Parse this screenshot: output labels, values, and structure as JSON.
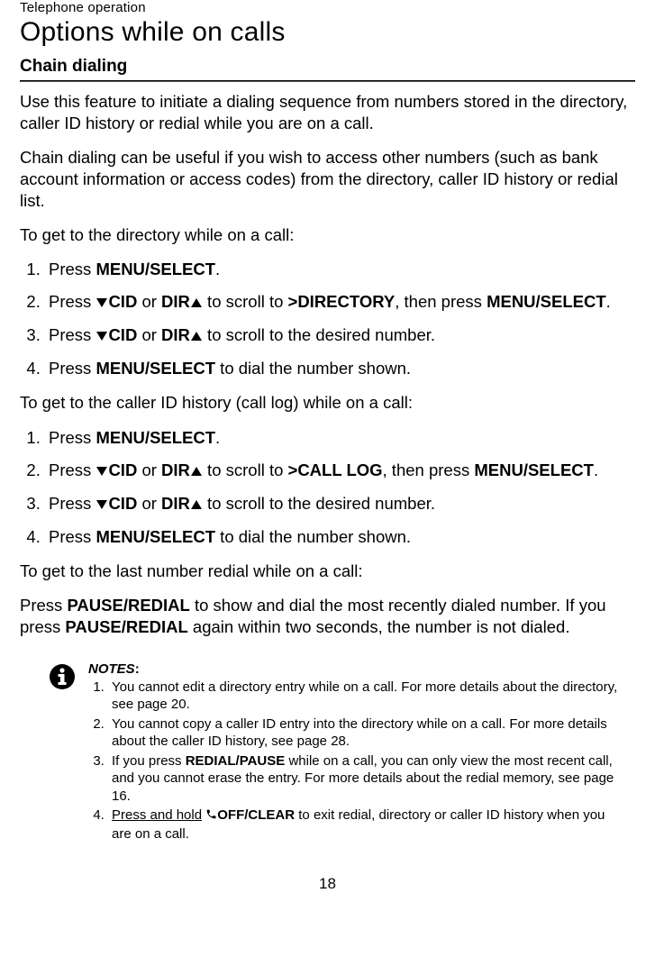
{
  "header": {
    "category": "Telephone operation",
    "title": "Options while on calls",
    "subhead": "Chain dialing"
  },
  "intro": {
    "p1": "Use this feature to initiate a dialing sequence from numbers stored in the directory, caller ID history or redial while you are on a call.",
    "p2": "Chain dialing can be useful if you wish to access other numbers (such as bank account information or access codes) from the directory, caller ID history or redial list."
  },
  "section1": {
    "lead": "To get to the directory while on a call:",
    "steps": {
      "s1_a": "Press ",
      "s1_b": "MENU/",
      "s1_c": "SELECT",
      "s1_d": ".",
      "s2_a": "Press ",
      "s2_cid": "CID",
      "s2_or": " or ",
      "s2_dir": "DIR",
      "s2_mid": " to scroll to ",
      "s2_target": ">DIRECTORY",
      "s2_then": ", then press ",
      "s2_menu": "MENU",
      "s2_sel": "/SELECT",
      "s2_end": ".",
      "s3_a": "Press ",
      "s3_mid": " to scroll to the desired number.",
      "s4_a": "Press ",
      "s4_menu": "MENU",
      "s4_sel": "/SELECT",
      "s4_end": " to dial the number shown."
    }
  },
  "section2": {
    "lead": "To get to the caller ID history (call log) while on a call:",
    "steps": {
      "s2_target": ">CALL LOG"
    }
  },
  "section3": {
    "lead": "To get to the last number redial while on a call:",
    "p_a": "Press ",
    "p_pause": "PAUSE",
    "p_red": "/REDIAL",
    "p_mid": " to show and dial the most recently dialed number. If you press ",
    "p_end": " again within two seconds, the number is not dialed."
  },
  "notes": {
    "title": "NOTES",
    "colon": ":",
    "n1": "You cannot edit a directory entry while on a call. For more details about the directory, see page 20.",
    "n2": "You cannot copy a caller ID entry into the directory while on a call. For more details about the caller ID history, see page 28.",
    "n3_a": "If you press ",
    "n3_red": "REDIAL/",
    "n3_pause": "PAUSE",
    "n3_b": " while on a call, you can only view the most recent call, and you cannot erase the entry. For more details about the redial memory, see page 16.",
    "n4_a": "Press and hold",
    "n4_off": "OFF/",
    "n4_clear": "CLEAR",
    "n4_b": " to exit redial, directory or caller ID history when you are on a call."
  },
  "page_number": "18"
}
